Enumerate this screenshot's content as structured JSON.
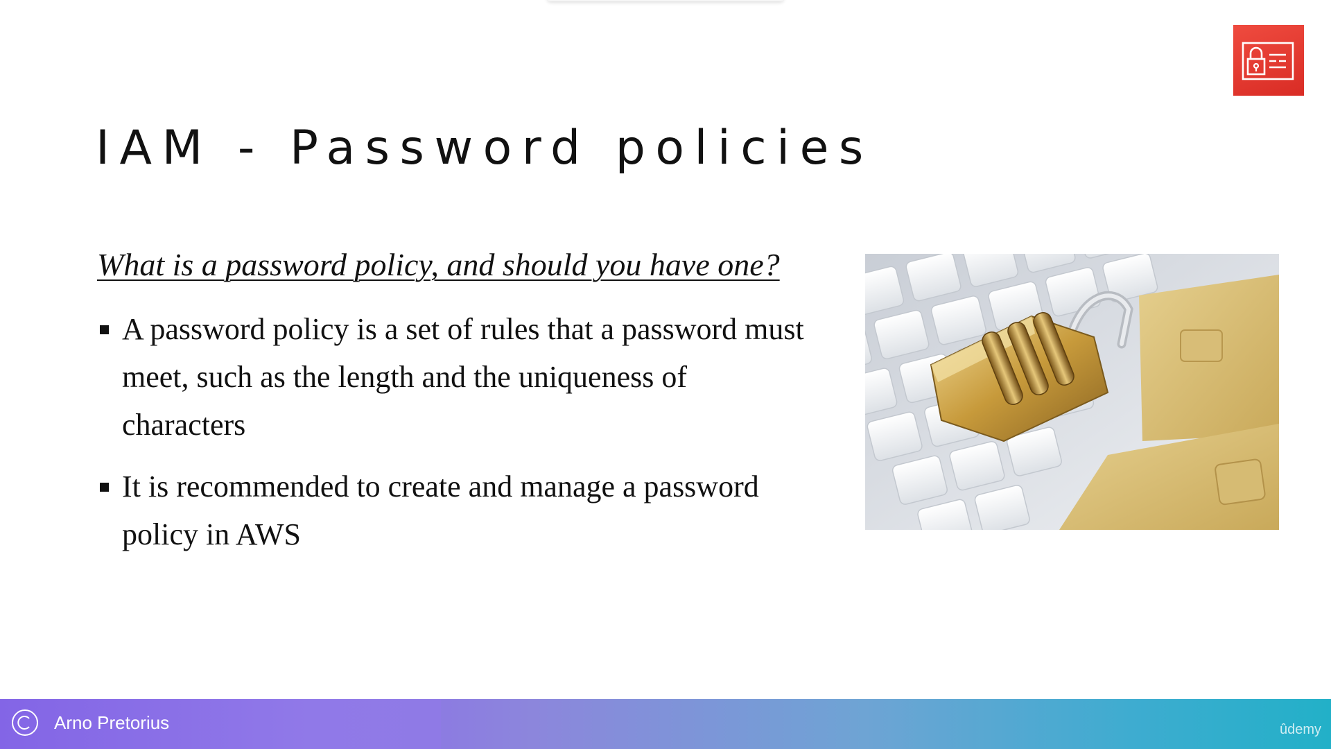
{
  "slide": {
    "title": "IAM - Password policies",
    "question": "What is a password policy, and should you have one?",
    "bullets": [
      "A password policy is a set of rules that a password must meet, such as the length and the uniqueness of characters",
      "It is recommended to create and manage a password policy in AWS"
    ],
    "photo_icon": "padlock-on-keyboard-image",
    "service_icon": "iam-identity-icon"
  },
  "footer": {
    "author": "Arno Pretorius",
    "brand": "ûdemy",
    "copyright_icon": "copyright-icon"
  },
  "colors": {
    "badge": "#e8382f",
    "footer_start": "#8365e6",
    "footer_end": "#22b0c8",
    "text": "#111111"
  }
}
